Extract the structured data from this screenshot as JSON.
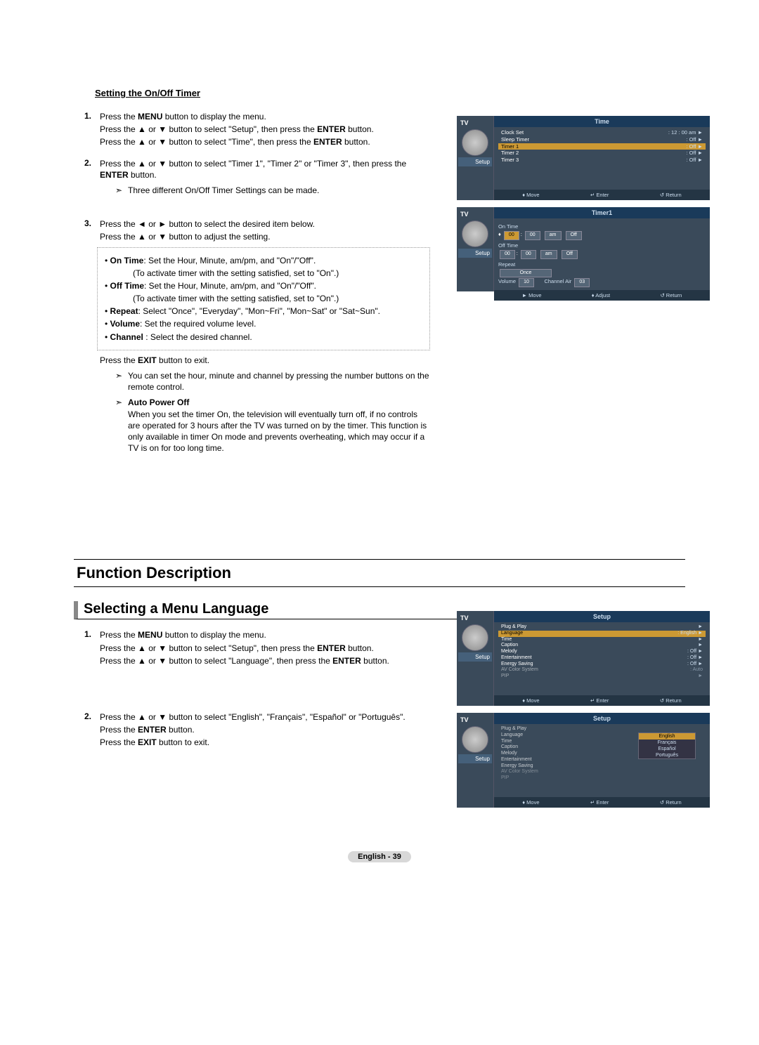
{
  "section1_title": "Setting the On/Off Timer",
  "steps1": {
    "s1": {
      "num": "1.",
      "l1a": "Press the ",
      "l1b": "MENU",
      "l1c": " button to display the menu.",
      "l2a": "Press the ▲ or ▼  button to select \"Setup\", then press the ",
      "l2b": "ENTER",
      "l2c": " button.",
      "l3a": "Press the ▲ or ▼ button to select \"Time\", then press the ",
      "l3b": "ENTER",
      "l3c": " button."
    },
    "s2": {
      "num": "2.",
      "l1a": "Press the ▲ or ▼ button to select \"Timer 1\", \"Timer 2\" or \"Timer 3\", then press the ",
      "l1b": "ENTER",
      "l1c": " button.",
      "note": "Three different On/Off Timer Settings can be made."
    },
    "s3": {
      "num": "3.",
      "l1": "Press the ◄ or ► button to select the desired item below.",
      "l2": "Press the ▲ or ▼ button to adjust the setting.",
      "b1a": "On Time",
      "b1b": ": Set the Hour, Minute, am/pm, and \"On\"/\"Off\".",
      "b1c": "(To activate timer with the setting satisfied, set to \"On\".)",
      "b2a": "Off Time",
      "b2b": ": Set the Hour, Minute, am/pm, and \"On\"/\"Off\".",
      "b2c": "(To activate timer with the setting satisfied, set to \"On\".)",
      "b3a": "Repeat",
      "b3b": ": Select \"Once\", \"Everyday\", \"Mon~Fri\", \"Mon~Sat\" or \"Sat~Sun\".",
      "b4a": "Volume",
      "b4b": ": Set the required volume level.",
      "b5a": "Channel",
      "b5b": " : Select the desired channel.",
      "after1a": "Press the ",
      "after1b": "EXIT",
      "after1c": " button to exit.",
      "note2": "You can set the hour, minute and channel by pressing the number buttons on the remote control.",
      "apo_title": "Auto Power Off",
      "apo_body": "When you set the timer On, the television will eventually turn off, if no controls are operated for 3 hours after the TV was turned on by the timer. This function is only available in timer On mode and prevents overheating, which may occur if a TV is on for too long time."
    }
  },
  "heading": "Function Description",
  "subheading": "Selecting a Menu Language",
  "steps2": {
    "s1": {
      "num": "1.",
      "l1a": "Press the ",
      "l1b": "MENU",
      "l1c": " button to display the menu.",
      "l2a": "Press the ▲ or ▼ button to select \"Setup\", then press the ",
      "l2b": "ENTER",
      "l2c": " button.",
      "l3a": "Press the ▲ or ▼ button to select \"Language\", then press the ",
      "l3b": "ENTER",
      "l3c": " button."
    },
    "s2": {
      "num": "2.",
      "l1": "Press the ▲ or ▼ button to select \"English\", \"Français\", \"Español\" or \"Português\".",
      "l2a": "Press the ",
      "l2b": "ENTER",
      "l2c": " button.",
      "l3a": "Press the ",
      "l3b": "EXIT",
      "l3c": " button to exit."
    }
  },
  "footer": "English - 39",
  "osd": {
    "tv": "TV",
    "setup": "Setup",
    "time": {
      "title": "Time",
      "rows": [
        {
          "l": "Clock Set",
          "r": ": 12 : 00 am"
        },
        {
          "l": "Sleep Timer",
          "r": ": Off"
        },
        {
          "l": "Timer 1",
          "r": ": Off"
        },
        {
          "l": "Timer 2",
          "r": ": Off"
        },
        {
          "l": "Timer 3",
          "r": ": Off"
        }
      ],
      "foot": {
        "a": "♦ Move",
        "b": "↵ Enter",
        "c": "↺ Return"
      }
    },
    "timer1": {
      "title": "Timer1",
      "on_label": "On Time",
      "off_label": "Off Time",
      "repeat_label": "Repeat",
      "repeat_val": "Once",
      "volume_label": "Volume",
      "volume_val": "10",
      "channel_label": "Channel",
      "channel_src": "Air",
      "channel_val": "03",
      "h": "00",
      "m": "00",
      "ap": "am",
      "st": "Off",
      "foot": {
        "a": "► Move",
        "b": "♦ Adjust",
        "c": "↺ Return"
      }
    },
    "setup1": {
      "title": "Setup",
      "rows": [
        {
          "l": "Plug & Play",
          "r": ""
        },
        {
          "l": "Language",
          "r": ": English"
        },
        {
          "l": "Time",
          "r": ""
        },
        {
          "l": "Caption",
          "r": ""
        },
        {
          "l": "Melody",
          "r": ": Off"
        },
        {
          "l": "Entertainment",
          "r": ": Off"
        },
        {
          "l": "Energy Saving",
          "r": ": Off"
        },
        {
          "l": "AV Color System",
          "r": ": Auto"
        },
        {
          "l": "PIP",
          "r": ""
        }
      ],
      "foot": {
        "a": "♦ Move",
        "b": "↵ Enter",
        "c": "↺ Return"
      }
    },
    "setup2": {
      "title": "Setup",
      "dropdown": [
        "English",
        "Français",
        "Español",
        "Português"
      ],
      "foot": {
        "a": "♦ Move",
        "b": "↵ Enter",
        "c": "↺ Return"
      }
    }
  }
}
